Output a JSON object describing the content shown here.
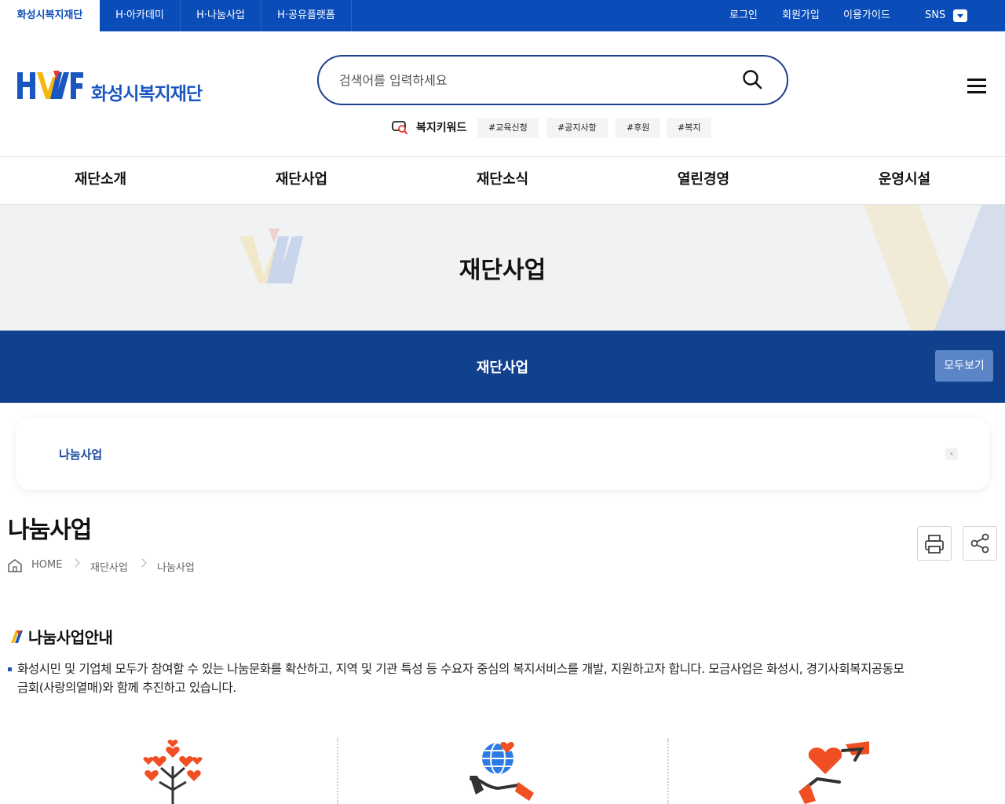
{
  "site_tabs": [
    "화성시복지재단",
    "H·아카데미",
    "H·나눔사업",
    "H·공유플랫폼"
  ],
  "util": {
    "login": "로그인",
    "join": "회원가입",
    "guide": "이용가이드",
    "sns": "SNS"
  },
  "logo": {
    "mark": "HWF",
    "name": "화성시복지재단"
  },
  "search": {
    "placeholder": "검색어를 입력하세요"
  },
  "keywords": {
    "title": "복지키워드",
    "tags": [
      "#교육신청",
      "#공지사항",
      "#후원",
      "#복지"
    ]
  },
  "gnb": [
    "재단소개",
    "재단사업",
    "재단소식",
    "열린경영",
    "운영시설"
  ],
  "visual": {
    "title": "재단사업"
  },
  "subbar": {
    "title": "재단사업",
    "view_all": "모두보기"
  },
  "subnav": {
    "current": "나눔사업",
    "arrow": "‹"
  },
  "page": {
    "title": "나눔사업",
    "breadcrumb": [
      "HOME",
      "재단사업",
      "나눔사업"
    ]
  },
  "content": {
    "section_title": "나눔사업안내",
    "description": "화성시민 및 기업체 모두가 참여할 수 있는 나눔문화를 확산하고, 지역 및 기관 특성 등 수요자 중심의 복지서비스를 개발, 지원하고자 합니다. 모금사업은 화성시, 경기사회복지공동모금회(사랑의열매)와 함께 추진하고 있습니다."
  },
  "colors": {
    "primary": "#0a4db8",
    "navy": "#11408d",
    "accent": "#f04e23",
    "yellow": "#f5b80f"
  },
  "icons": [
    "search-icon",
    "menu-icon",
    "keyword-icon",
    "home-icon",
    "print-icon",
    "share-icon",
    "hearts-tree-icon",
    "globe-hand-icon",
    "heart-hands-icon"
  ]
}
